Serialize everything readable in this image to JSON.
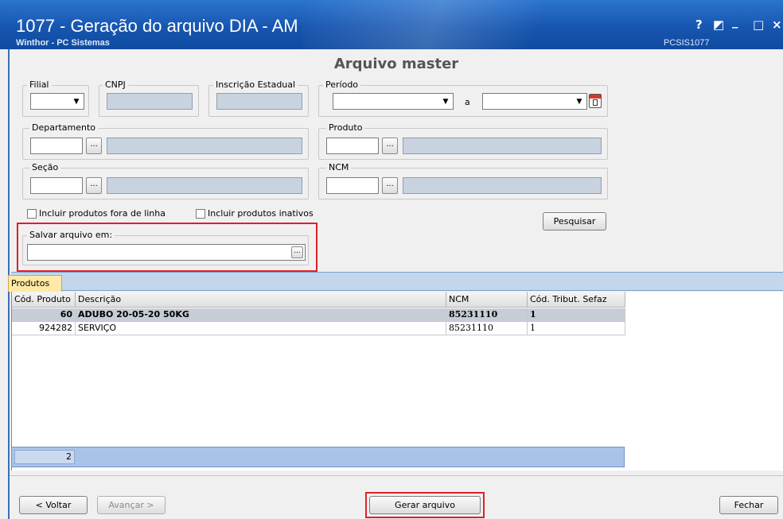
{
  "window": {
    "title": "1077 - Geração do arquivo DIA - AM",
    "subtitle": "Winthor - PC Sistemas",
    "code": "PCSIS1077",
    "controls": {
      "help": "?",
      "restore": "◩",
      "minimize": "_",
      "maximize": "□",
      "close": "×"
    }
  },
  "panel_title": "Arquivo master",
  "filters": {
    "filial_label": "Filial",
    "filial_value": "",
    "cnpj_label": "CNPJ",
    "cnpj_value": "",
    "ie_label": "Inscrição Estadual",
    "ie_value": "",
    "periodo_label": "Período",
    "periodo_from": "",
    "periodo_sep": "a",
    "periodo_to": "",
    "departamento_label": "Departamento",
    "departamento_code": "",
    "departamento_desc": "",
    "produto_label": "Produto",
    "produto_code": "",
    "produto_desc": "",
    "secao_label": "Seção",
    "secao_code": "",
    "secao_desc": "",
    "ncm_label": "NCM",
    "ncm_code": "",
    "ncm_desc": "",
    "dots": "...",
    "fora_linha_label": "Incluir produtos fora de linha",
    "inativos_label": "Incluir produtos inativos",
    "pesquisar_label": "Pesquisar",
    "salvar_label": "Salvar arquivo em:",
    "salvar_value": ""
  },
  "tabs": [
    {
      "label": "Produtos"
    }
  ],
  "grid": {
    "columns": [
      "Cód. Produto",
      "Descrição",
      "NCM",
      "Cód. Tribut. Sefaz"
    ],
    "rows": [
      {
        "codigo": "60",
        "descricao": "ADUBO 20-05-20 50KG",
        "ncm": "85231110",
        "tribut": "1"
      },
      {
        "codigo": "924282",
        "descricao": "SERVIÇO",
        "ncm": "85231110",
        "tribut": "1"
      }
    ],
    "count": "2"
  },
  "footer": {
    "voltar": "< Voltar",
    "avancar": "Avançar >",
    "gerar": "Gerar arquivo",
    "fechar": "Fechar"
  },
  "colors": {
    "title_bar": "#1756b0",
    "highlight": "#e01f2a",
    "tab": "#ffe9a6"
  }
}
